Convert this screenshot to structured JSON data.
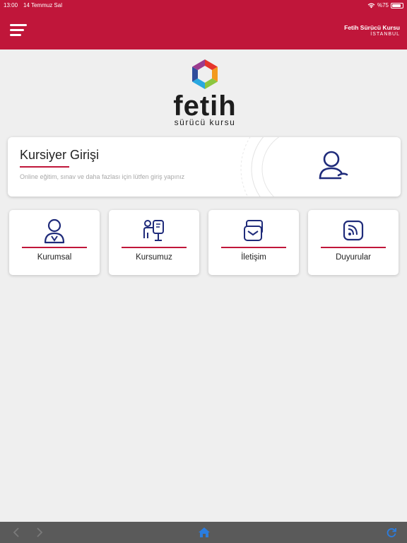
{
  "status_bar": {
    "time": "13:00",
    "date": "14 Temmuz Sal",
    "battery": "%75"
  },
  "header": {
    "brand_name": "Fetih Sürücü Kursu",
    "brand_city": "İSTANBUL"
  },
  "logo": {
    "word": "fetih",
    "sub": "sürücü kursu"
  },
  "login_card": {
    "title": "Kursiyer Girişi",
    "description": "Online eğitim, sınav ve daha fazlası için lütfen giriş yapınız"
  },
  "tiles": [
    {
      "label": "Kurumsal",
      "icon": "user-badge-icon"
    },
    {
      "label": "Kursumuz",
      "icon": "classroom-icon"
    },
    {
      "label": "İletişim",
      "icon": "mail-icon"
    },
    {
      "label": "Duyurular",
      "icon": "rss-icon"
    }
  ],
  "colors": {
    "accent": "#c0163a",
    "icon": "#1f2b7a",
    "bottom_bar": "#5a5a5a",
    "active_blue": "#2a7de1"
  }
}
